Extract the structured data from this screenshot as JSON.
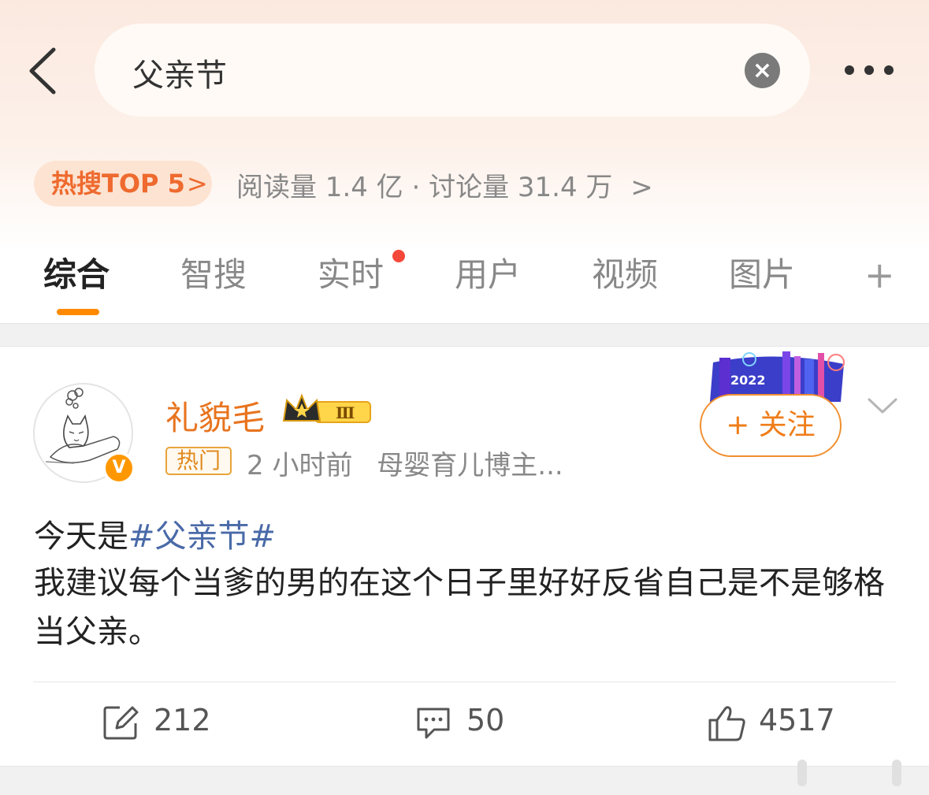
{
  "search": {
    "query": "父亲节"
  },
  "hot": {
    "badge": "热搜TOP 5",
    "stats": "阅读量 1.4 亿 · 讨论量 31.4 万"
  },
  "tabs": [
    {
      "label": "综合",
      "active": true
    },
    {
      "label": "智搜"
    },
    {
      "label": "实时",
      "has_dot": true
    },
    {
      "label": "用户"
    },
    {
      "label": "视频"
    },
    {
      "label": "图片"
    }
  ],
  "post": {
    "username": "礼貌毛",
    "member_level": "Ⅲ",
    "badge_tag": "热门",
    "time": "2 小时前",
    "profile_desc": "母婴育儿博主...",
    "follow_label": "+ 关注",
    "banner_year": "2022",
    "text_prefix": "今天是",
    "topic": "#父亲节#",
    "body": "我建议每个当爹的男的在这个日子里好好反省自己是不是够格当父亲。",
    "reposts": "212",
    "comments": "50",
    "likes": "4517"
  },
  "colors": {
    "accent_orange": "#ef7d19",
    "topic_blue": "#4a6aa8",
    "hot_badge_bg": "#fde3d2",
    "red_dot": "#f4483a"
  },
  "icons": [
    "back-icon",
    "clear-icon",
    "more-icon",
    "chevron-right-icon",
    "plus-icon",
    "crown-icon",
    "verified-icon",
    "chevron-down-icon",
    "repost-icon",
    "comment-icon",
    "like-icon"
  ]
}
